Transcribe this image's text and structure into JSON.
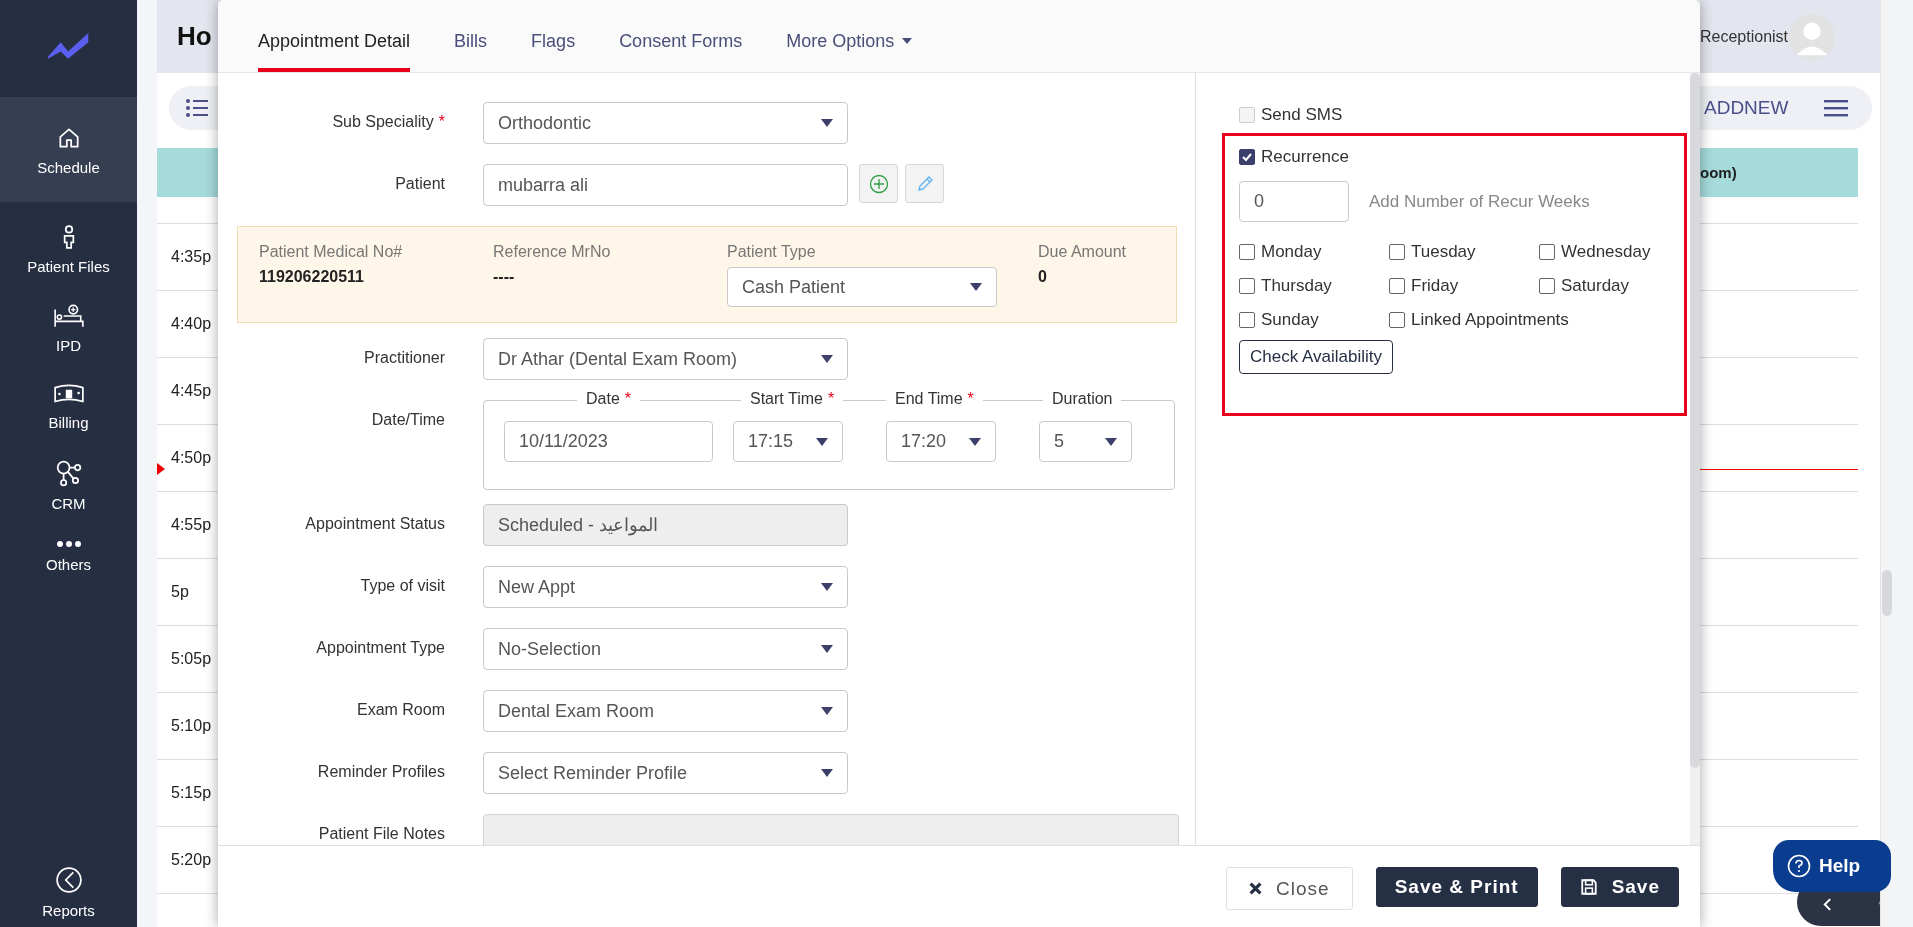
{
  "sidebar": {
    "items": [
      {
        "label": "Schedule",
        "selected": true
      },
      {
        "label": "Patient Files",
        "selected": false
      },
      {
        "label": "IPD",
        "selected": false
      },
      {
        "label": "Billing",
        "selected": false
      },
      {
        "label": "CRM",
        "selected": false
      },
      {
        "label": "Others",
        "selected": false
      }
    ],
    "bottom_item": {
      "label": "Reports",
      "selected": false
    }
  },
  "page": {
    "title": "Ho",
    "user": "Receptionist",
    "add_button": "ADDNEW",
    "column_header": "oom)",
    "time_slots": [
      {
        "time": "4:35p",
        "current": false
      },
      {
        "time": "4:40p",
        "current": false
      },
      {
        "time": "4:45p",
        "current": false
      },
      {
        "time": "4:50p",
        "current": true
      },
      {
        "time": "4:55p",
        "current": false
      },
      {
        "time": "5p",
        "current": false
      },
      {
        "time": "5:05p",
        "current": false
      },
      {
        "time": "5:10p",
        "current": false
      },
      {
        "time": "5:15p",
        "current": false
      },
      {
        "time": "5:20p",
        "current": false
      }
    ],
    "help_button": "Help"
  },
  "modal": {
    "tabs": [
      {
        "label": "Appointment Detail",
        "selected": true,
        "dropdown": false
      },
      {
        "label": "Bills",
        "selected": false,
        "dropdown": false
      },
      {
        "label": "Flags",
        "selected": false,
        "dropdown": false
      },
      {
        "label": "Consent Forms",
        "selected": false,
        "dropdown": false
      },
      {
        "label": "More Options",
        "selected": false,
        "dropdown": true
      }
    ],
    "fields": [
      {
        "kind": "select",
        "label": "Sub Speciality",
        "required_mark": "*",
        "value": "Orthodontic"
      },
      {
        "kind": "patient",
        "label": "Patient",
        "value": "mubarra ali"
      },
      {
        "kind": "info",
        "items": [
          {
            "label": "Patient Medical No#",
            "value": "119206220511",
            "select": false
          },
          {
            "label": "Reference MrNo",
            "value": "----",
            "select": false
          },
          {
            "label": "Patient Type",
            "value": "Cash Patient",
            "select": true
          },
          {
            "label": "Due Amount",
            "value": "0",
            "select": false
          }
        ]
      },
      {
        "kind": "select",
        "label": "Practitioner",
        "value": "Dr Athar (Dental Exam Room)"
      },
      {
        "kind": "datetime",
        "label": "Date/Time",
        "parts": [
          {
            "legend": "Date",
            "required_mark": "*",
            "value": "10/11/2023",
            "select": false
          },
          {
            "legend": "Start Time",
            "required_mark": "*",
            "value": "17:15",
            "select": true
          },
          {
            "legend": "End Time",
            "required_mark": "*",
            "value": "17:20",
            "select": true
          },
          {
            "legend": "Duration",
            "value": "5",
            "select": true
          }
        ]
      },
      {
        "kind": "readonly",
        "label": "Appointment Status",
        "value": "Scheduled - المواعيد"
      },
      {
        "kind": "select",
        "label": "Type of visit",
        "value": "New Appt"
      },
      {
        "kind": "select",
        "label": "Appointment Type",
        "value": "No-Selection"
      },
      {
        "kind": "select",
        "label": "Exam Room",
        "value": "Dental Exam Room"
      },
      {
        "kind": "select",
        "label": "Reminder Profiles",
        "value": "Select Reminder Profile"
      },
      {
        "kind": "notes",
        "label": "Patient File Notes"
      }
    ],
    "send_sms": {
      "label": "Send SMS",
      "checked": false,
      "disabled": true
    },
    "recurrence": {
      "label": "Recurrence",
      "checked": true
    },
    "recur_weeks": {
      "value": "0",
      "label": "Add Number of Recur Weeks"
    },
    "days": [
      {
        "label": "Monday",
        "checked": false
      },
      {
        "label": "Tuesday",
        "checked": false
      },
      {
        "label": "Wednesday",
        "checked": false
      },
      {
        "label": "Thursday",
        "checked": false
      },
      {
        "label": "Friday",
        "checked": false
      },
      {
        "label": "Saturday",
        "checked": false
      },
      {
        "label": "Sunday",
        "checked": false
      },
      {
        "label": "Linked Appointments",
        "checked": false
      }
    ],
    "check_button": "Check Availability",
    "footer_buttons": [
      {
        "label": "Close",
        "kind": "close"
      },
      {
        "label": "Save & Print",
        "kind": "print"
      },
      {
        "label": "Save",
        "kind": "save"
      }
    ]
  }
}
